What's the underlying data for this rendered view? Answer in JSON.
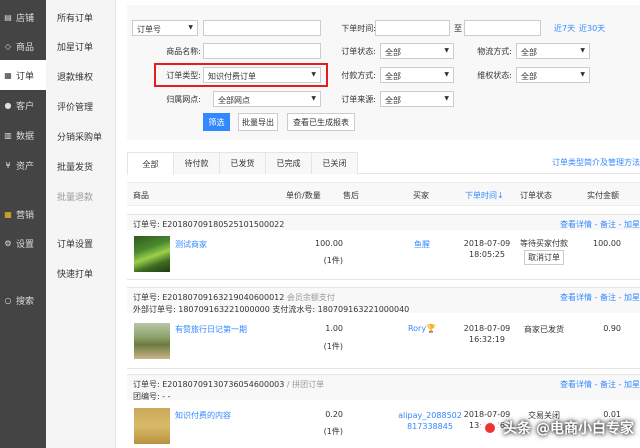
{
  "primary_nav": [
    {
      "label": "店铺",
      "icon": "shop-icon"
    },
    {
      "label": "商品",
      "icon": "tag-icon"
    },
    {
      "label": "订单",
      "icon": "clipboard-icon"
    },
    {
      "label": "客户",
      "icon": "user-icon"
    },
    {
      "label": "数据",
      "icon": "chart-icon"
    },
    {
      "label": "资产",
      "icon": "currency-icon"
    },
    {
      "label": "营销",
      "icon": "grid-icon"
    },
    {
      "label": "设置",
      "icon": "gear-icon"
    },
    {
      "label": "搜索",
      "icon": "search-icon"
    }
  ],
  "sub_nav": [
    "所有订单",
    "加星订单",
    "退款维权",
    "评价管理",
    "分销采购单",
    "批量发货",
    "批量退款",
    "订单设置",
    "快速打单"
  ],
  "filters": {
    "order_no_select": "订单号",
    "order_time_label": "下单时间:",
    "date_sep": "至",
    "last7": "近7天",
    "last30": "近30天",
    "product_name_label": "商品名称:",
    "order_status_label": "订单状态:",
    "order_status_value": "全部",
    "logistics_label": "物流方式:",
    "logistics_value": "全部",
    "order_type_label": "订单类型:",
    "order_type_value": "知识付费订单",
    "payment_label": "付款方式:",
    "payment_value": "全部",
    "rights_label": "维权状态:",
    "rights_value": "全部",
    "outlet_label": "归属网点:",
    "outlet_value": "全部网点",
    "source_label": "订单来源:",
    "source_value": "全部",
    "filter_btn": "筛选",
    "export_btn": "批量导出",
    "report_btn": "查看已生成报表"
  },
  "tabs": [
    "全部",
    "待付款",
    "已发货",
    "已完成",
    "已关闭"
  ],
  "tabs_link": "订单类型简介及管理方法",
  "columns": {
    "product": "商品",
    "price_qty": "单价/数量",
    "after_sale": "售后",
    "buyer": "买家",
    "order_time": "下单时间↓",
    "status": "订单状态",
    "paid": "实付金额"
  },
  "orders": [
    {
      "order_no": "订单号: E20180709180525101500022",
      "note": "",
      "line2": "",
      "actions": "查看详情 - 备注 - 加星",
      "product": "测试商家",
      "price": "100.00",
      "qty": "(1件)",
      "buyer": "鱼腥",
      "date": "2018-07-09",
      "time": "18:05:25",
      "status": "等待买家付款",
      "status_btn": "取消订单",
      "paid": "100.00"
    },
    {
      "order_no": "订单号: E20180709163219040600012",
      "note": "会员余额支付",
      "line2": "外部订单号: 180709163221000000       支付流水号: 180709163221000040",
      "actions": "查看详情 - 备注 - 加星",
      "product": "有赞旅行日记第一期",
      "price": "1.00",
      "qty": "(1件)",
      "buyer": "Rory🏆",
      "date": "2018-07-09",
      "time": "16:32:19",
      "status": "商家已发货",
      "status_btn": "",
      "paid": "0.90"
    },
    {
      "order_no": "订单号: E20180709130736054600003",
      "note": "/ 拼团订单",
      "line2": "团编号: - -",
      "actions": "查看详情 - 备注 - 加星",
      "product": "知识付费的内容",
      "price": "0.20",
      "qty": "(1件)",
      "buyer": "alipay_2088502 817338845",
      "date": "2018-07-09",
      "time": "13:07:36",
      "status": "交易关闭",
      "status_btn": "",
      "paid": "0.01"
    }
  ],
  "watermark": "头条 @电商小白专家",
  "colors": {
    "accent": "#3388ff",
    "sidebar": "#444444",
    "highlight": "#e02020"
  }
}
